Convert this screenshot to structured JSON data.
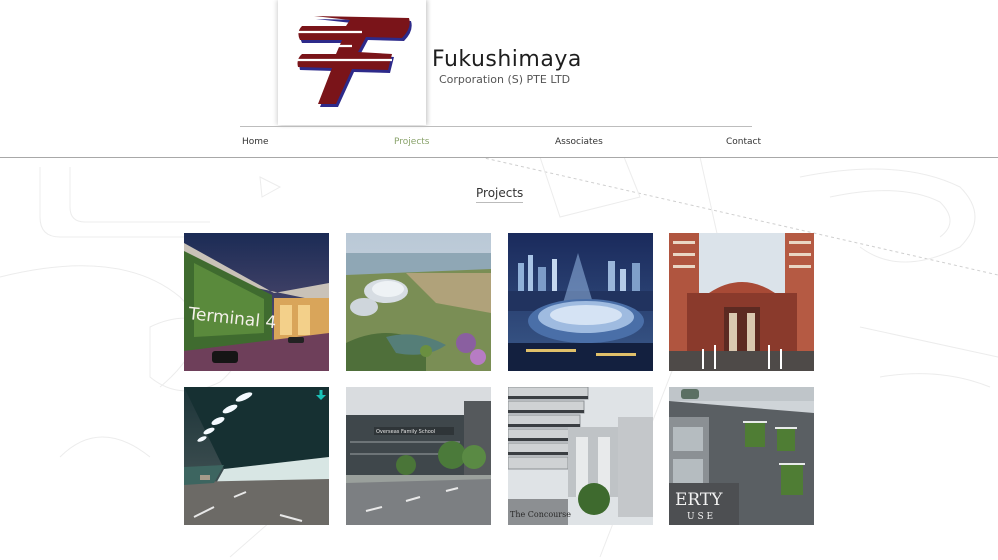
{
  "brand": {
    "name": "Fukushimaya",
    "subtitle": "Corporation (S) PTE LTD",
    "logo_colors": {
      "primary": "#7a1419",
      "shadow": "#2d2a8a"
    }
  },
  "nav": {
    "items": [
      {
        "label": "Home",
        "active": false
      },
      {
        "label": "Projects",
        "active": true
      },
      {
        "label": "Associates",
        "active": false
      },
      {
        "label": "Contact",
        "active": false
      }
    ],
    "active_color": "#8aa36b"
  },
  "section": {
    "title": "Projects"
  },
  "gallery": {
    "items": [
      {
        "name": "terminal-4",
        "sign_text": "Terminal 4"
      },
      {
        "name": "gardens-by-the-bay"
      },
      {
        "name": "sports-hub-stadium"
      },
      {
        "name": "civic-building-fountains"
      },
      {
        "name": "road-tunnel",
        "badge_icon": "download-arrow-icon"
      },
      {
        "name": "office-building-street",
        "sign_text": "Overseas Family School"
      },
      {
        "name": "concourse-tower",
        "sign_text": "The Concourse"
      },
      {
        "name": "green-wall-building",
        "sign_text": "ERTY"
      }
    ]
  }
}
